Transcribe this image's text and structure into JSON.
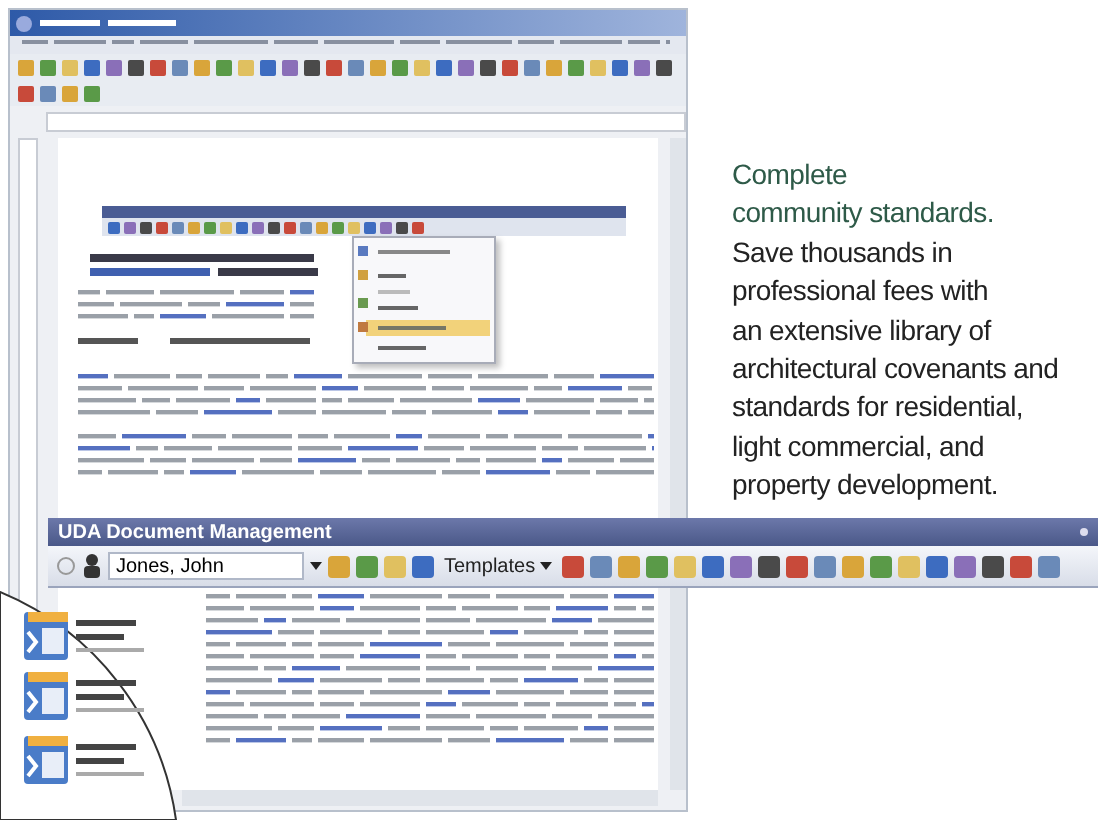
{
  "promo": {
    "heading": "Complete\ncommunity standards.",
    "body": "Save thousands in\nprofessional fees with\nan extensive library of\narchitectural covenants and\nstandards for residential,\nlight commercial, and\nproperty development."
  },
  "uda_toolbar": {
    "title": "UDA Document Management",
    "user_field": {
      "value": "Jones, John"
    },
    "templates_button": "Templates"
  }
}
